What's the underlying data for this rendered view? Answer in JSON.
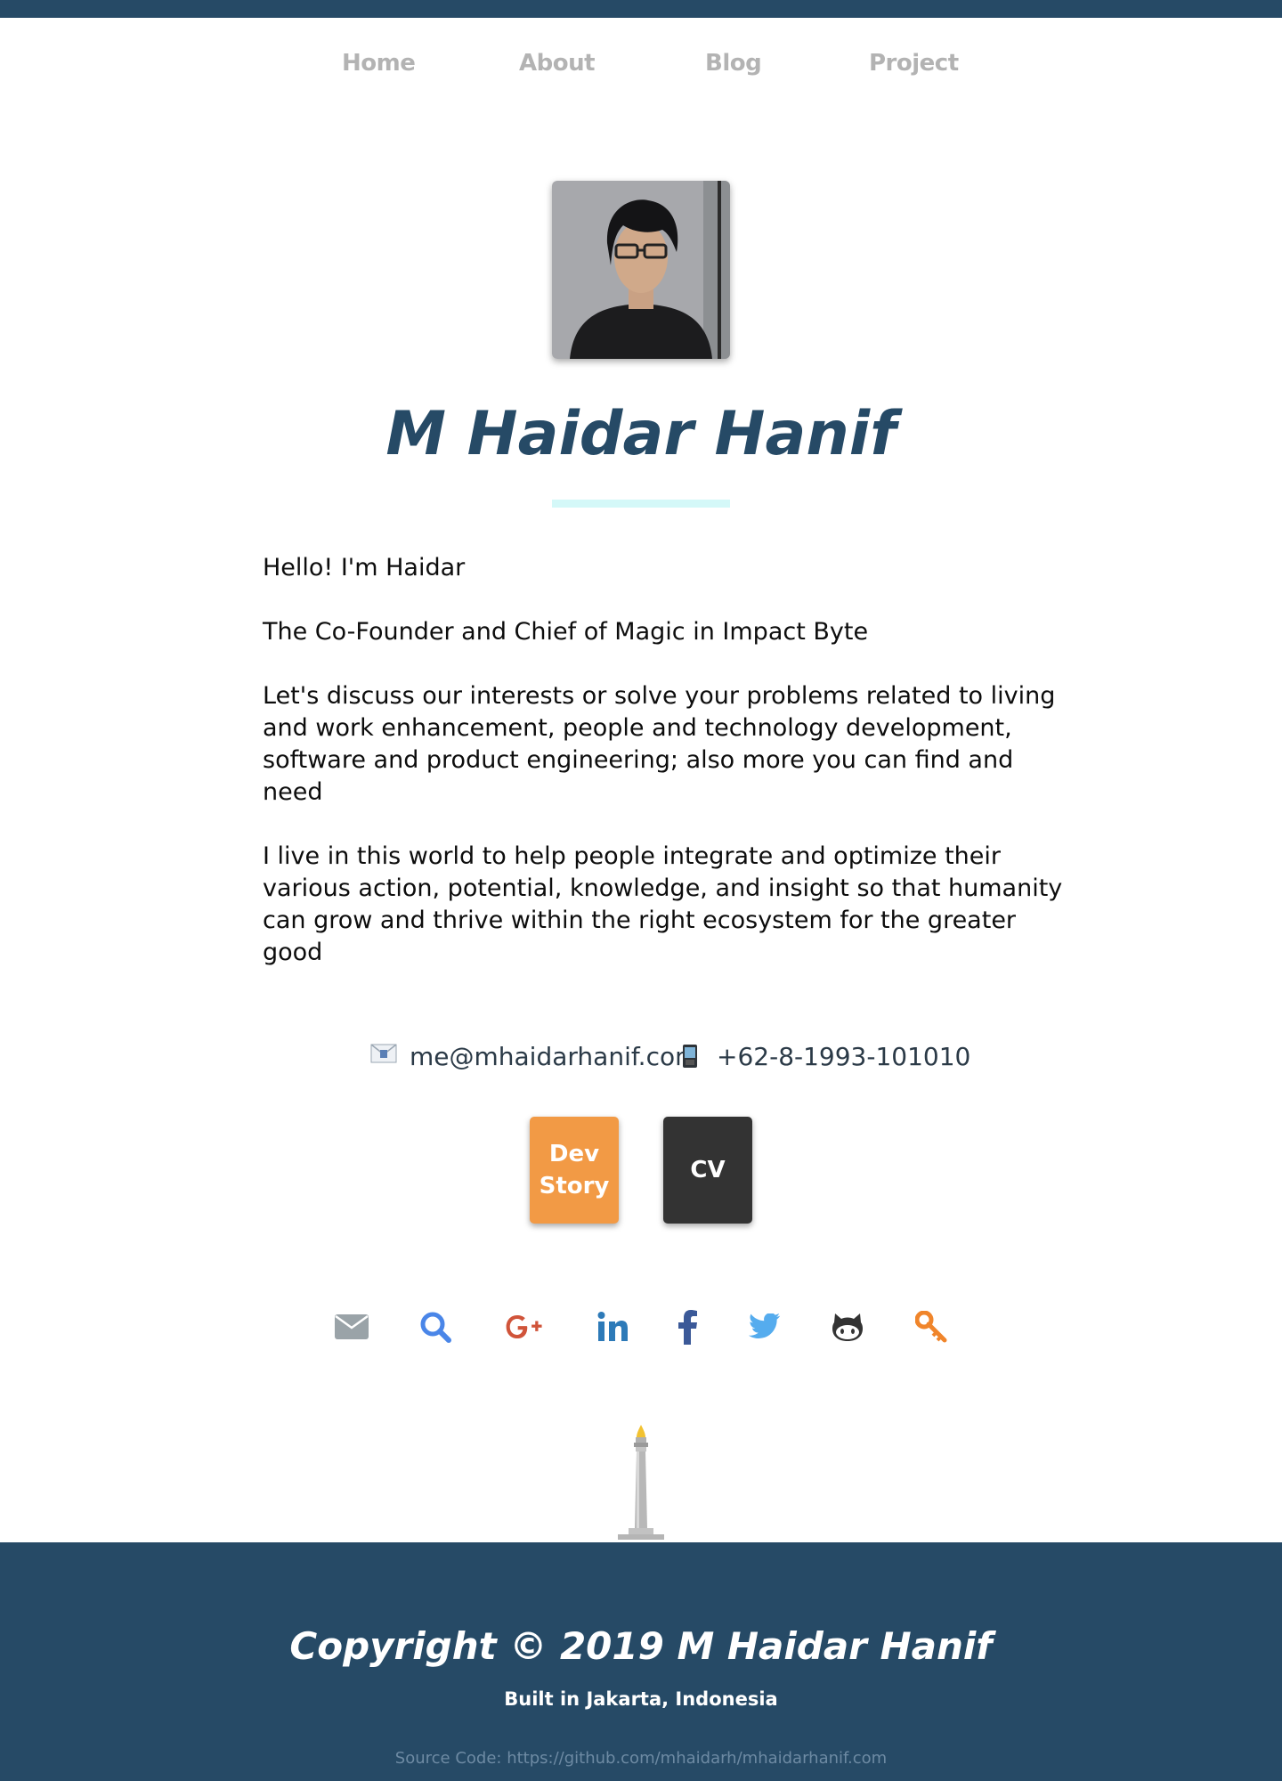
{
  "nav": {
    "items": [
      {
        "label": "Home"
      },
      {
        "label": "About"
      },
      {
        "label": "Blog"
      },
      {
        "label": "Project"
      }
    ]
  },
  "profile": {
    "name": "M Haidar Hanif",
    "bio": [
      "Hello! I'm Haidar",
      "The Co-Founder and Chief of Magic in Impact Byte",
      "Let's discuss our interests or solve your problems related to living and work enhancement, people and technology development, software and product engineering; also more you can find and need",
      "I live in this world to help people integrate and optimize their various action, potential, knowledge, and insight so that humanity can grow and thrive within the right ecosystem for the greater good"
    ]
  },
  "contact": {
    "email": "me@mhaidarhanif.com",
    "phone": "+62-8-1993-101010",
    "email_icon": "envelope-icon",
    "phone_icon": "mobile-phone-icon"
  },
  "buttons": {
    "dev_story": "Dev Story",
    "cv": "CV"
  },
  "social": [
    {
      "icon": "email-icon",
      "color": "#9aa3a8"
    },
    {
      "icon": "search-icon",
      "color": "#4a86e8"
    },
    {
      "icon": "google-plus-icon",
      "color": "#d0543a"
    },
    {
      "icon": "linkedin-icon",
      "color": "#2d7ab8"
    },
    {
      "icon": "facebook-icon",
      "color": "#3b5998"
    },
    {
      "icon": "twitter-icon",
      "color": "#55acee"
    },
    {
      "icon": "github-icon",
      "color": "#333333"
    },
    {
      "icon": "keybase-icon",
      "color": "#f0852b"
    }
  ],
  "footer": {
    "copyright": "Copyright © 2019 M Haidar Hanif",
    "built": "Built in Jakarta, Indonesia",
    "source": "Source Code: https://github.com/mhaidarh/mhaidarhanif.com"
  },
  "colors": {
    "primary": "#264a66",
    "accent_underline": "#d4f8f8",
    "dev_story_button": "#f29a45",
    "cv_button": "#333333",
    "nav_text": "#b3b3b3"
  }
}
